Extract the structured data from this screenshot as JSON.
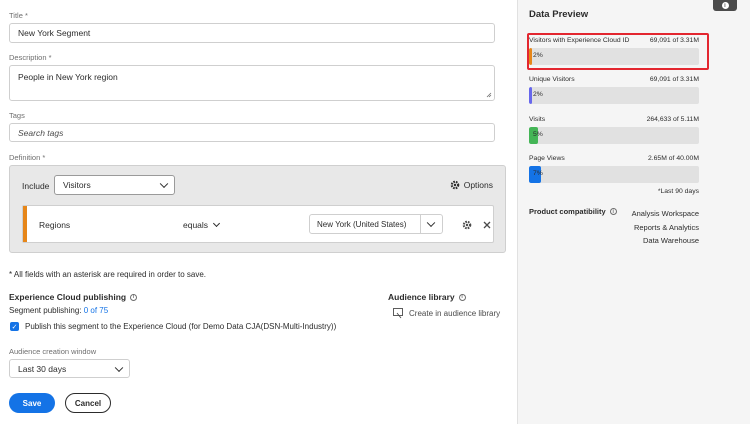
{
  "form": {
    "title_label": "Title",
    "title_value": "New York Segment",
    "description_label": "Description",
    "description_value": "People in New York region",
    "tags_label": "Tags",
    "tags_placeholder": "Search tags",
    "definition_label": "Definition",
    "required_mark": "*"
  },
  "definition": {
    "include_label": "Include",
    "include_value": "Visitors",
    "options_label": "Options",
    "rule": {
      "field": "Regions",
      "operator": "equals",
      "value": "New York (United States)",
      "grip_color": "#e68619"
    }
  },
  "required_note": "All fields with an asterisk are required in order to save.",
  "publishing": {
    "title": "Experience Cloud publishing",
    "count_label": "Segment publishing:",
    "count_value": "0 of 75",
    "checkbox_label": "Publish this segment to the Experience Cloud (for Demo Data CJA(DSN-Multi-Industry))",
    "checked": true
  },
  "audience_library": {
    "title": "Audience library",
    "create_label": "Create in audience library"
  },
  "audience_window": {
    "label": "Audience creation window",
    "value": "Last 30 days"
  },
  "buttons": {
    "save": "Save",
    "cancel": "Cancel"
  },
  "data_preview": {
    "title": "Data Preview",
    "metrics": [
      {
        "name": "Visitors with Experience Cloud ID",
        "value": "69,091 of 3.31M",
        "percent_label": "2%",
        "fill": 0.02,
        "color": "#e68619"
      },
      {
        "name": "Unique Visitors",
        "value": "69,091 of 3.31M",
        "percent_label": "2%",
        "fill": 0.02,
        "color": "#6767ec"
      },
      {
        "name": "Visits",
        "value": "264,633 of 5.11M",
        "percent_label": "5%",
        "fill": 0.05,
        "color": "#44b556"
      },
      {
        "name": "Page Views",
        "value": "2.65M of 40.00M",
        "percent_label": "7%",
        "fill": 0.07,
        "color": "#1473e6"
      }
    ],
    "last_days": "*Last 90 days",
    "product_compat_title": "Product compatibility",
    "products": [
      "Analysis Workspace",
      "Reports & Analytics",
      "Data Warehouse"
    ],
    "highlight_color": "#e3262f"
  },
  "colors": {
    "accent": "#1473e6"
  }
}
